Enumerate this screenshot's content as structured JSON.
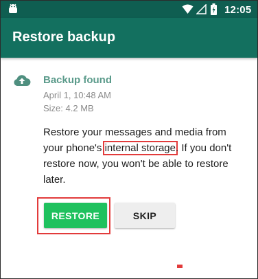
{
  "status_bar": {
    "time": "12:05",
    "icons": [
      "android-icon",
      "wifi-icon",
      "signal-icon",
      "battery-charging-icon"
    ],
    "color": "#0f5e51"
  },
  "app_bar": {
    "title": "Restore backup",
    "color": "#13705f"
  },
  "backup": {
    "icon": "cloud-upload-icon",
    "title": "Backup found",
    "date": "April 1, 10:48 AM",
    "size": "Size: 4.2 MB"
  },
  "description": {
    "part1": "Restore your messages and media from your phone's ",
    "highlight": "internal storage",
    "part2": ". If you don't restore now, you won't be able to restore later."
  },
  "buttons": {
    "restore_label": "RESTORE",
    "skip_label": "SKIP"
  },
  "colors": {
    "accent_green": "#1fc15e",
    "title_teal": "#5a9a8a",
    "highlight_box": "#e23b3b"
  }
}
